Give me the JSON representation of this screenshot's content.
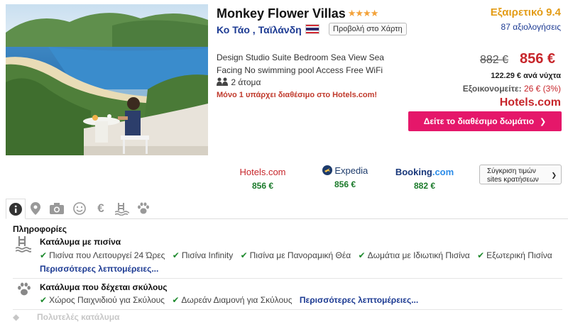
{
  "hotel": {
    "name": "Monkey Flower Villas",
    "stars": "★★★★",
    "location": "Κο Τάο , Ταϊλάνδη",
    "map_button": "Προβολή στο Χάρτη",
    "room_description": "Design Studio Suite Bedroom Sea View Sea Facing No swimming pool Access Free WiFi",
    "persons": "2 άτομα",
    "availability_note": "Μόνο 1 υπάρχει διαθέσιμο στο Hotels.com!"
  },
  "rating": {
    "label": "Εξαιρετικό 9.4",
    "reviews": "87 αξιολογήσεις"
  },
  "pricing": {
    "old_price": "882 €",
    "new_price": "856 €",
    "per_night": "122.29 € ανά νύχτα",
    "savings_label": "Εξοικονομείτε:",
    "savings_value": "26 € (3%)",
    "provider_logo": "Hotels.com",
    "cta_label": "Δείτε το διαθέσιμο δωμάτιο"
  },
  "compare": {
    "providers": [
      {
        "name": "Hotels.com",
        "price": "856 €"
      },
      {
        "name": "Expedia",
        "price": "856 €"
      },
      {
        "name_main": "Booking",
        "name_suffix": ".com",
        "price": "882 €"
      }
    ],
    "button_line1": "Σύγκριση τιμών",
    "button_line2": "sites κρατήσεων"
  },
  "tabs": [
    {
      "icon": "info-icon",
      "active": true
    },
    {
      "icon": "map-pin-icon"
    },
    {
      "icon": "camera-icon"
    },
    {
      "icon": "smiley-icon"
    },
    {
      "icon": "euro-icon"
    },
    {
      "icon": "pool-icon"
    },
    {
      "icon": "paw-icon"
    }
  ],
  "info": {
    "heading": "Πληροφορίες",
    "sections": [
      {
        "title": "Κατάλυμα με πισίνα",
        "icon": "pool-icon",
        "items": [
          "Πισίνα που Λειτουργεί 24 Ώρες",
          "Πισίνα Infinity",
          "Πισίνα με Πανοραμική Θέα",
          "Δωμάτια με Ιδιωτική Πισίνα",
          "Εξωτερική Πισίνα"
        ],
        "more": "Περισσότερες λεπτομέρειες..."
      },
      {
        "title": "Κατάλυμα που δέχεται σκύλους",
        "icon": "paw-icon",
        "items": [
          "Χώρος Παιχνιδιού για Σκύλους",
          "Δωρεάν Διαμονή για Σκύλους"
        ],
        "more": "Περισσότερες λεπτομέρειες..."
      },
      {
        "title": "Πολυτελές κατάλυμα",
        "icon": "diamond-icon"
      }
    ]
  },
  "colors": {
    "brand_red": "#c7262b",
    "cta_pink": "#e5176a",
    "link_blue": "#1d3b93",
    "rating_orange": "#e39c17",
    "check_green": "#1e8a2e"
  }
}
